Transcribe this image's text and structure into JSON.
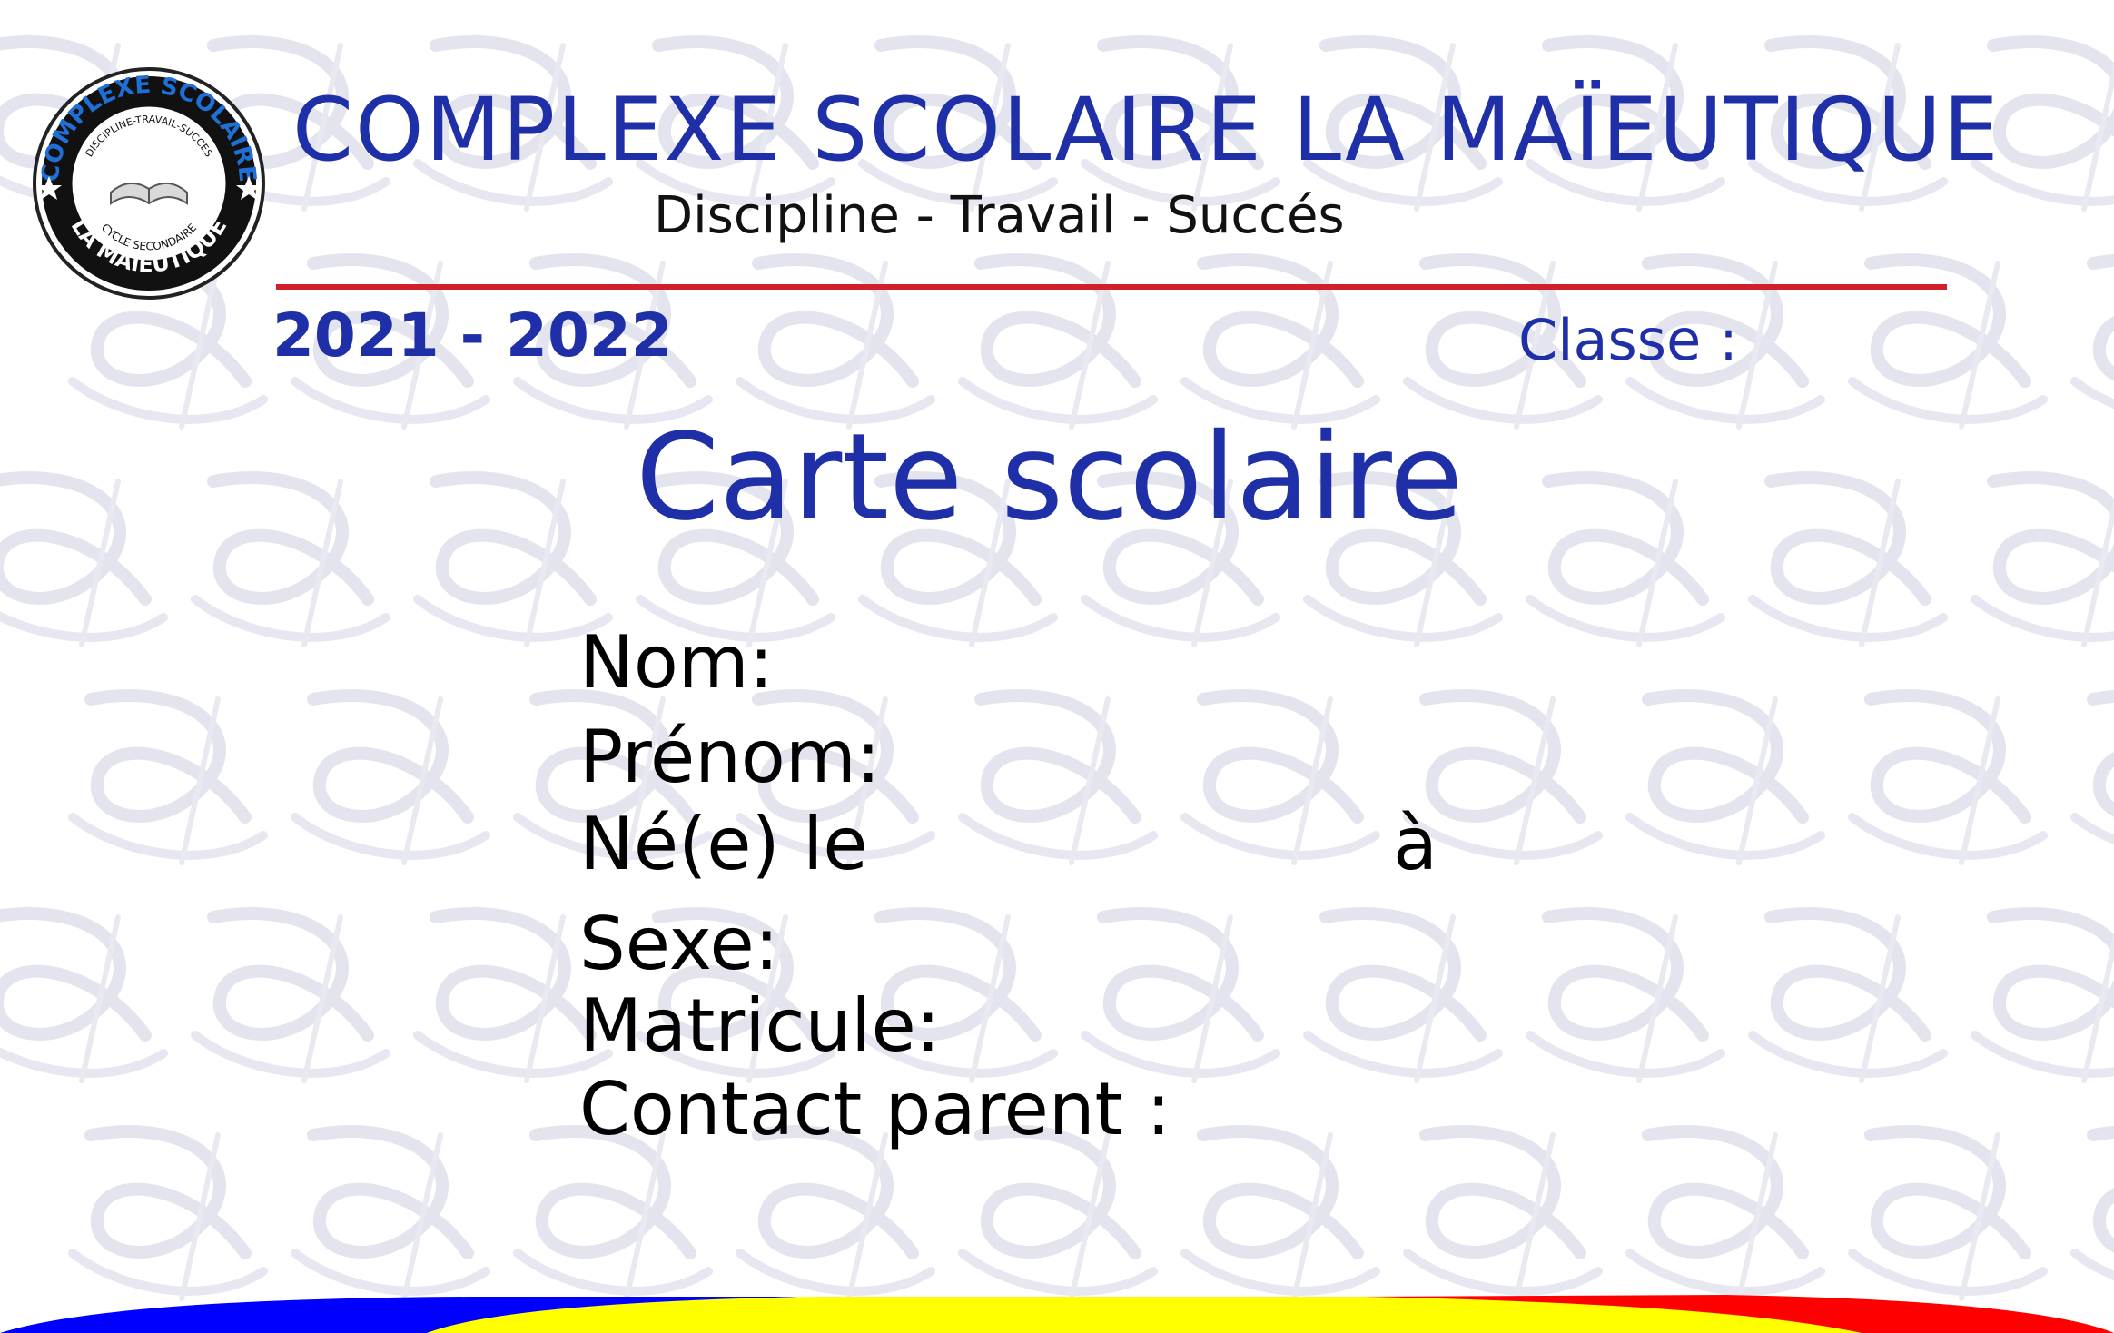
{
  "header": {
    "school_name": "COMPLEXE SCOLAIRE LA MAÏEUTIQUE",
    "motto": "Discipline - Travail - Succés",
    "year": "2021 - 2022",
    "classe_label": "Classe :"
  },
  "logo": {
    "ring_top_text": "COMPLEXE SCOLAIRE",
    "inner_top_text": "DISCIPLINE-TRAVAIL-SUCCES",
    "inner_bottom_text": "CYCLE SECONDAIRE",
    "ring_bottom_text": "LA MAÏEUTIQUE"
  },
  "card": {
    "title": "Carte scolaire",
    "fields": {
      "nom": "Nom:",
      "prenom": "Prénom:",
      "ne_le": "Né(e) le",
      "a": "à",
      "sexe": "Sexe:",
      "matricule": "Matricule:",
      "contact_parent": "Contact parent :"
    }
  },
  "colors": {
    "primary_blue": "#1f2fa8",
    "divider_red": "#d0202a",
    "stripe_blue": "#0000ff",
    "stripe_yellow": "#ffff00",
    "stripe_red": "#ff0000",
    "watermark": "#e3e4ee"
  },
  "icons": [
    "open-book-icon",
    "star-icon"
  ]
}
